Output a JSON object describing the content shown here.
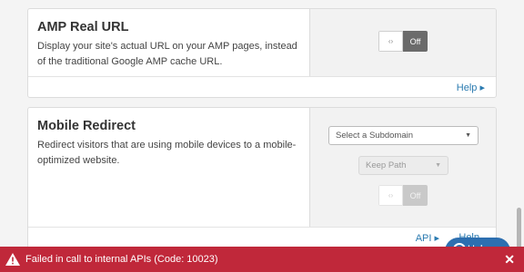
{
  "amp_card": {
    "title": "AMP Real URL",
    "description": "Display your site's actual URL on your AMP pages, instead of the traditional Google AMP cache URL.",
    "toggle_icon": "‹›",
    "toggle_state": "Off",
    "help_link": "Help ▸"
  },
  "mobile_card": {
    "title": "Mobile Redirect",
    "description": "Redirect visitors that are using mobile devices to a mobile-optimized website.",
    "subdomain_select": "Select a Subdomain",
    "path_select": "Keep Path",
    "toggle_icon": "‹›",
    "toggle_state": "Off",
    "api_link": "API ▸",
    "help_link_partial": "Help"
  },
  "help_widget": {
    "label": "Help"
  },
  "alert": {
    "message": "Failed in call to internal APIs (Code: 10023)",
    "close": "✕"
  },
  "colors": {
    "alert_bg": "#c0283a",
    "link": "#2a7ab0",
    "help_widget": "#2d6fb0"
  }
}
